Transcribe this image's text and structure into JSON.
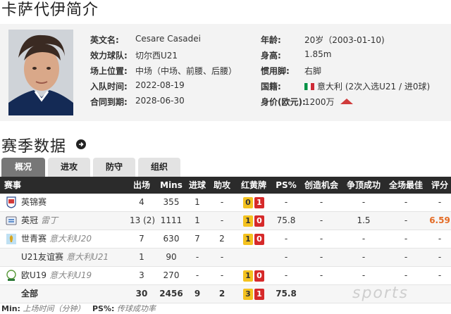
{
  "page_title": "卡萨代伊简介",
  "profile": {
    "fields_left": [
      {
        "label": "英文名:",
        "value": "Cesare Casadei"
      },
      {
        "label": "效力球队:",
        "value": "切尔西U21"
      },
      {
        "label": "场上位置:",
        "value": "中场（中场、前腰、后腰）"
      },
      {
        "label": "入队时间:",
        "value": "2022-08-19"
      },
      {
        "label": "合同到期:",
        "value": "2028-06-30"
      }
    ],
    "fields_right": [
      {
        "label": "年龄:",
        "value": "20岁（2003-01-10)"
      },
      {
        "label": "身高:",
        "value": "1.85m"
      },
      {
        "label": "惯用脚:",
        "value": "右脚"
      },
      {
        "label": "国籍:",
        "value": "意大利 (2次入选U21 / 进0球)"
      },
      {
        "label": "身价(欧元):",
        "value": "1200万"
      }
    ],
    "value_trend": "up"
  },
  "section_title": "赛季数据",
  "tabs": [
    {
      "label": "概况",
      "active": true
    },
    {
      "label": "进攻",
      "active": false
    },
    {
      "label": "防守",
      "active": false
    },
    {
      "label": "组织",
      "active": false
    }
  ],
  "table": {
    "headers": [
      "赛事",
      "出场",
      "Mins",
      "进球",
      "助攻",
      "红黄牌",
      "PS%",
      "创造机会",
      "争顶成功",
      "全场最佳",
      "评分"
    ],
    "rows": [
      {
        "competition": "英锦赛",
        "team": "",
        "apps": "4",
        "mins": "355",
        "goals": "1",
        "assists": "-",
        "yellow": "0",
        "red": "1",
        "ps": "-",
        "chances": "-",
        "aerials": "-",
        "motm": "-",
        "rating": "-",
        "icon": "efl-trophy-icon"
      },
      {
        "competition": "英冠",
        "team": "雷丁",
        "apps": "13 (2)",
        "mins": "1111",
        "goals": "1",
        "assists": "-",
        "yellow": "1",
        "red": "0",
        "ps": "75.8",
        "chances": "-",
        "aerials": "1.5",
        "motm": "-",
        "rating": "6.59",
        "icon": "championship-icon"
      },
      {
        "competition": "世青赛",
        "team": "意大利U20",
        "apps": "7",
        "mins": "630",
        "goals": "7",
        "assists": "2",
        "yellow": "1",
        "red": "0",
        "ps": "-",
        "chances": "-",
        "aerials": "-",
        "motm": "-",
        "rating": "-",
        "icon": "u20-world-cup-icon"
      },
      {
        "competition": "U21友谊赛",
        "team": "意大利U21",
        "apps": "1",
        "mins": "90",
        "goals": "-",
        "assists": "-",
        "yellow": "",
        "red": "",
        "ps": "-",
        "chances": "-",
        "aerials": "-",
        "motm": "-",
        "rating": "-",
        "icon": ""
      },
      {
        "competition": "欧U19",
        "team": "意大利U19",
        "apps": "3",
        "mins": "270",
        "goals": "-",
        "assists": "-",
        "yellow": "1",
        "red": "0",
        "ps": "-",
        "chances": "-",
        "aerials": "-",
        "motm": "-",
        "rating": "-",
        "icon": "euro-u19-icon"
      }
    ],
    "total": {
      "label": "全部",
      "apps": "30",
      "mins": "2456",
      "goals": "9",
      "assists": "2",
      "yellow": "3",
      "red": "1",
      "ps": "75.8"
    }
  },
  "footer": {
    "min_key": "Min:",
    "min_text": "上场时间（分钟）",
    "ps_key": "PS%:",
    "ps_text": "传球成功率"
  },
  "watermark": "sports"
}
